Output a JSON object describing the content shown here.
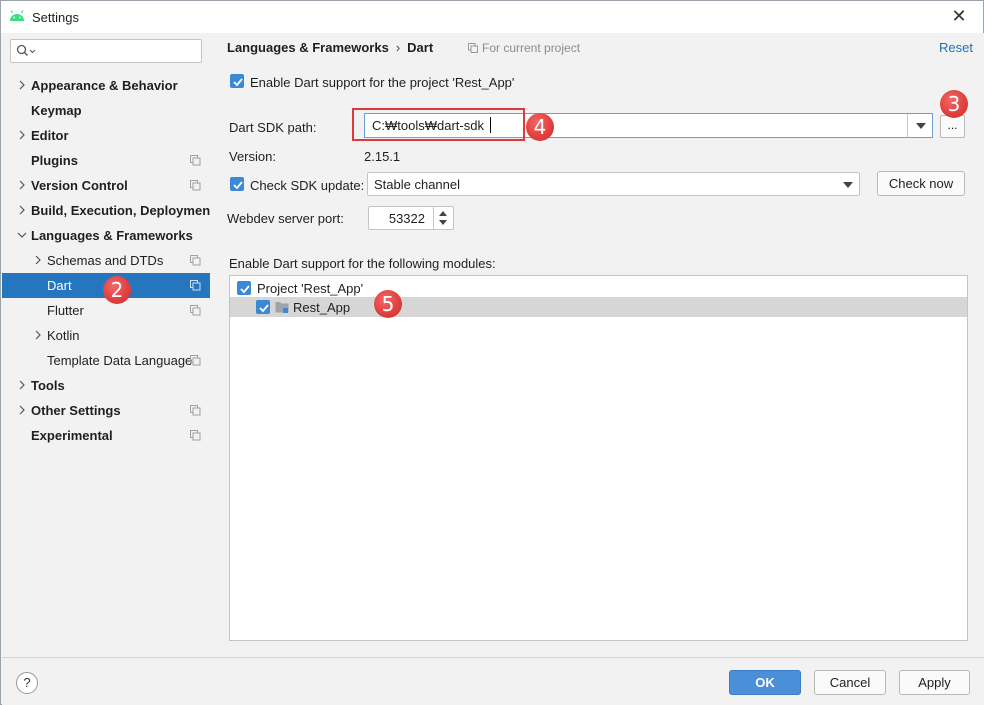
{
  "window": {
    "title": "Settings",
    "close_glyph": "✕",
    "app_icon": "android-icon"
  },
  "sidebar": {
    "search": {
      "value": "",
      "placeholder": ""
    },
    "items": [
      {
        "label": "Appearance & Behavior",
        "bold": true,
        "expandable": true,
        "expanded": false,
        "project_icon": false
      },
      {
        "label": "Keymap",
        "bold": true,
        "expandable": false,
        "project_icon": false
      },
      {
        "label": "Editor",
        "bold": true,
        "expandable": true,
        "expanded": false,
        "project_icon": false
      },
      {
        "label": "Plugins",
        "bold": true,
        "expandable": false,
        "project_icon": true
      },
      {
        "label": "Version Control",
        "bold": true,
        "expandable": true,
        "expanded": false,
        "project_icon": true
      },
      {
        "label": "Build, Execution, Deployment",
        "bold": true,
        "expandable": true,
        "expanded": false,
        "project_icon": false
      },
      {
        "label": "Languages & Frameworks",
        "bold": true,
        "expandable": true,
        "expanded": true,
        "project_icon": false
      },
      {
        "label": "Schemas and DTDs",
        "bold": false,
        "expandable": true,
        "expanded": false,
        "project_icon": true
      },
      {
        "label": "Dart",
        "bold": false,
        "expandable": false,
        "project_icon": true,
        "selected": true
      },
      {
        "label": "Flutter",
        "bold": false,
        "expandable": false,
        "project_icon": true
      },
      {
        "label": "Kotlin",
        "bold": false,
        "expandable": true,
        "expanded": false,
        "project_icon": false
      },
      {
        "label": "Template Data Languages",
        "bold": false,
        "expandable": false,
        "project_icon": true
      },
      {
        "label": "Tools",
        "bold": true,
        "expandable": true,
        "expanded": false,
        "project_icon": false
      },
      {
        "label": "Other Settings",
        "bold": true,
        "expandable": true,
        "expanded": false,
        "project_icon": true
      },
      {
        "label": "Experimental",
        "bold": true,
        "expandable": false,
        "project_icon": true
      }
    ]
  },
  "main": {
    "breadcrumb": {
      "parent": "Languages & Frameworks",
      "separator": "›",
      "current": "Dart"
    },
    "for_current_project": "For current project",
    "reset_label": "Reset",
    "enable_dart": {
      "label": "Enable Dart support for the project 'Rest_App'",
      "checked": true
    },
    "sdk_path": {
      "label": "Dart SDK path:",
      "value": "C:₩tools₩dart-sdk",
      "browse_label": "..."
    },
    "version": {
      "label": "Version:",
      "value": "2.15.1"
    },
    "check_sdk_update": {
      "label": "Check SDK update:",
      "checked": true,
      "channel": "Stable channel",
      "check_now_label": "Check now"
    },
    "webdev_port": {
      "label": "Webdev server port:",
      "value": "53322"
    },
    "modules": {
      "label": "Enable Dart support for the following modules:",
      "project": {
        "label": "Project 'Rest_App'",
        "checked": true
      },
      "module": {
        "label": "Rest_App",
        "checked": true,
        "icon": "folder-module-icon"
      }
    }
  },
  "annotations": {
    "badge_2": "2",
    "badge_3": "3",
    "badge_4": "4",
    "badge_5": "5"
  },
  "footer": {
    "help_label": "?",
    "ok_label": "OK",
    "cancel_label": "Cancel",
    "apply_label": "Apply"
  },
  "colors": {
    "selection": "#2675bf",
    "checkbox": "#3b89d4",
    "link": "#2470b3",
    "primary_button": "#4a8fd8",
    "annotation": "#e2403e"
  }
}
